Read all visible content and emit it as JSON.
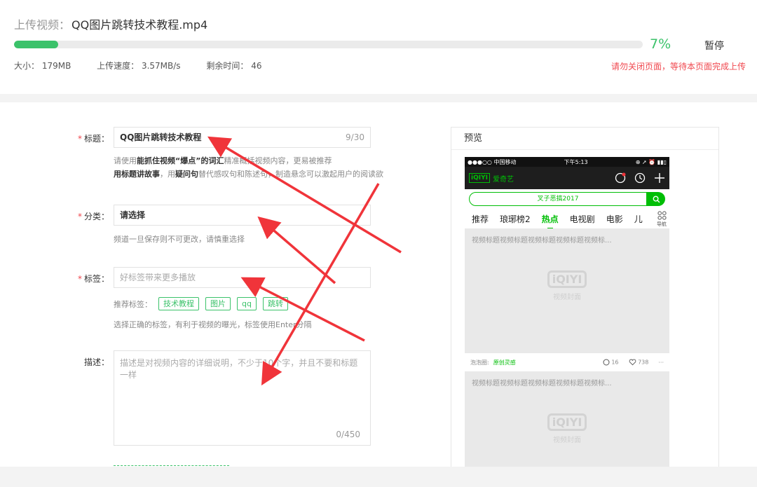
{
  "upload": {
    "label": "上传视频：",
    "filename": "QQ图片跳转技术教程.mp4",
    "progress_percent": 7,
    "progress_text": "7%",
    "pause_label": "暂停",
    "size": "大小： 179MB",
    "speed": "上传速度： 3.57MB/s",
    "remaining": "剩余时间： 46",
    "warning": "请勿关闭页面，等待本页面完成上传"
  },
  "form": {
    "title_label": "标题：",
    "title_value": "QQ图片跳转技术教程",
    "title_count": "9/30",
    "title_hint_1a": "请使用",
    "title_hint_1b": "能抓住视频“爆点”的词汇",
    "title_hint_1c": "精准概括视频内容，更易被推荐",
    "title_hint_2a": "用标题讲故事",
    "title_hint_2b": "，用",
    "title_hint_2c": "疑问句",
    "title_hint_2d": "替代感叹句和陈述句，制造悬念可以激起用户的阅读欲",
    "category_label": "分类：",
    "category_value": "请选择",
    "category_hint": "频道一旦保存则不可更改，请慎重选择",
    "tags_label": "标签：",
    "tags_placeholder": "好标签带来更多播放",
    "suggested_label": "推荐标签：",
    "suggested_tags": [
      "技术教程",
      "图片",
      "qq",
      "跳转"
    ],
    "tags_hint": "选择正确的标签，有利于视频的曝光，标签使用Enter分隔",
    "desc_label": "描述：",
    "desc_placeholder": "描述是对视频内容的详细说明，不少于10个字，并且不要和标题一样",
    "desc_count": "0/450"
  },
  "preview": {
    "title": "预览",
    "status_left": "●●●○○ 中国移动 ",
    "status_time": "下午5:13",
    "status_right": "⊕ ➚ ⏰ ▮▮▯",
    "app_logo": "iQIYI",
    "app_name": "爱奇艺",
    "search_text": "叉子恶搞2017",
    "tabs": [
      "推荐",
      "琅琊榜2",
      "热点",
      "电视剧",
      "电影",
      "儿"
    ],
    "active_tab": "热点",
    "nav_label": "导航",
    "card_title": "视频标题视频标题视频标题视频标题视频标...",
    "cover_logo": "iQIYI",
    "cover_text": "视频封面",
    "meta_source_label": "泡泡圈:",
    "meta_source_value": "原创灵感",
    "comments": "16",
    "likes": "738",
    "more": "···",
    "card2_title": "视频标题视频标题视频标题视频标题视频标..."
  },
  "colors": {
    "accent": "#3bc26a",
    "iqiyi_green": "#00be06",
    "warning": "#f0484f",
    "annotation_arrow": "#f0343a"
  }
}
